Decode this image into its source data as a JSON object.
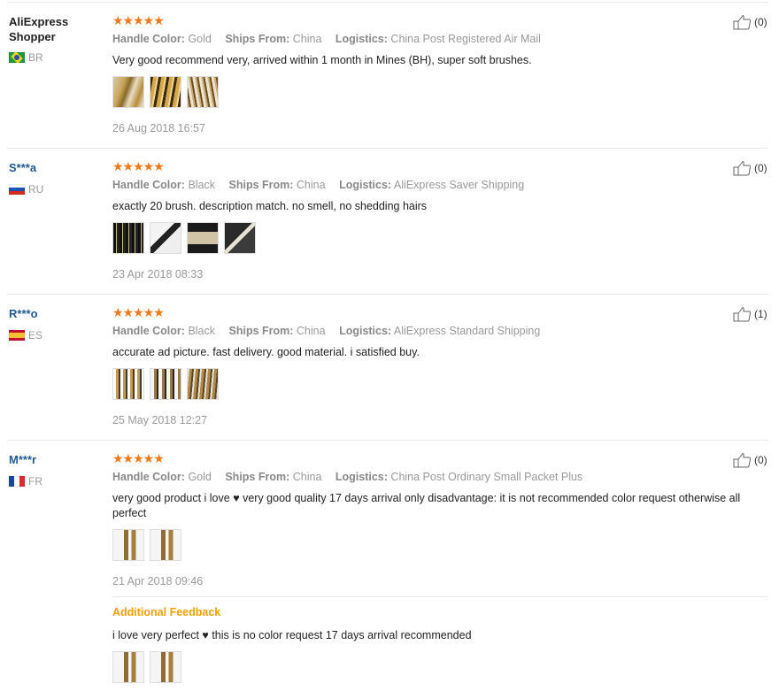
{
  "attr_labels": {
    "handle_color": "Handle Color:",
    "ships_from": "Ships From:",
    "logistics": "Logistics:"
  },
  "stars": "★★★★★",
  "reviews": [
    {
      "user": "AliExpress Shopper",
      "user_line1": "AliExpress",
      "user_line2": "Shopper",
      "country": "BR",
      "handle_color": "Gold",
      "ships_from": "China",
      "logistics": "China Post Registered Air Mail",
      "text": "Very good recommend very, arrived within 1 month in Mines (BH), super soft brushes.",
      "date": "26 Aug 2018 16:57",
      "likes": "(0)"
    },
    {
      "user": "S***a",
      "country": "RU",
      "handle_color": "Black",
      "ships_from": "China",
      "logistics": "AliExpress Saver Shipping",
      "text": "exactly 20 brush. description match. no smell, no shedding hairs",
      "date": "23 Apr 2018 08:33",
      "likes": "(0)"
    },
    {
      "user": "R***o",
      "country": "ES",
      "handle_color": "Black",
      "ships_from": "China",
      "logistics": "AliExpress Standard Shipping",
      "text": "accurate ad picture. fast delivery. good material. i satisfied buy.",
      "date": "25 May 2018 12:27",
      "likes": "(1)"
    },
    {
      "user": "M***r",
      "country": "FR",
      "handle_color": "Gold",
      "ships_from": "China",
      "logistics": "China Post Ordinary Small Packet Plus",
      "text": "very good product i love ♥ very good quality 17 days arrival only disadvantage: it is not recommended color request otherwise all perfect",
      "date": "21 Apr 2018 09:46",
      "likes": "(0)",
      "additional_title": "Additional Feedback",
      "additional_text": "i love very perfect ♥ this is no color request 17 days arrival recommended"
    }
  ],
  "colors": {
    "stars": "#f0781b",
    "link": "#1f5a96",
    "additional": "#f0a000",
    "muted": "#999999"
  }
}
